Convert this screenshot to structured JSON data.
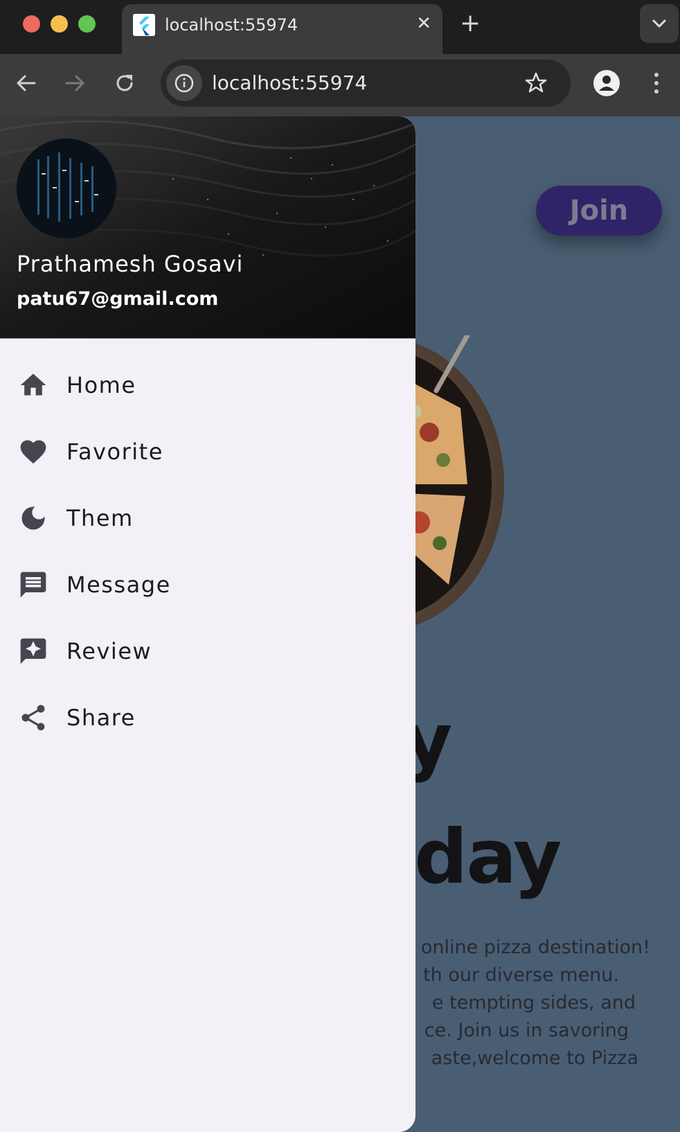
{
  "browser": {
    "tab_title": "localhost:55974",
    "tab_close": "✕",
    "new_tab": "+",
    "url": "localhost:55974"
  },
  "page": {
    "join_label": "Join",
    "hero_line1": "day",
    "hero_line2": "er day",
    "description": [
      "online pizza destination!",
      "th our diverse menu.",
      "e tempting sides, and",
      "ce. Join us in savoring",
      "aste,welcome to Pizza"
    ]
  },
  "drawer": {
    "user_name": "Prathamesh Gosavi",
    "user_email": "patu67@gmail.com",
    "items": [
      {
        "label": "Home",
        "icon": "home-icon"
      },
      {
        "label": "Favorite",
        "icon": "heart-icon"
      },
      {
        "label": "Them",
        "icon": "moon-icon"
      },
      {
        "label": "Message",
        "icon": "message-icon"
      },
      {
        "label": "Review",
        "icon": "review-icon"
      },
      {
        "label": "Share",
        "icon": "share-icon"
      }
    ]
  },
  "colors": {
    "drawer_bg": "#f3f0f7",
    "page_bg": "#4a5e73",
    "join_bg": "#2f2468",
    "icon_color": "#49454f"
  }
}
